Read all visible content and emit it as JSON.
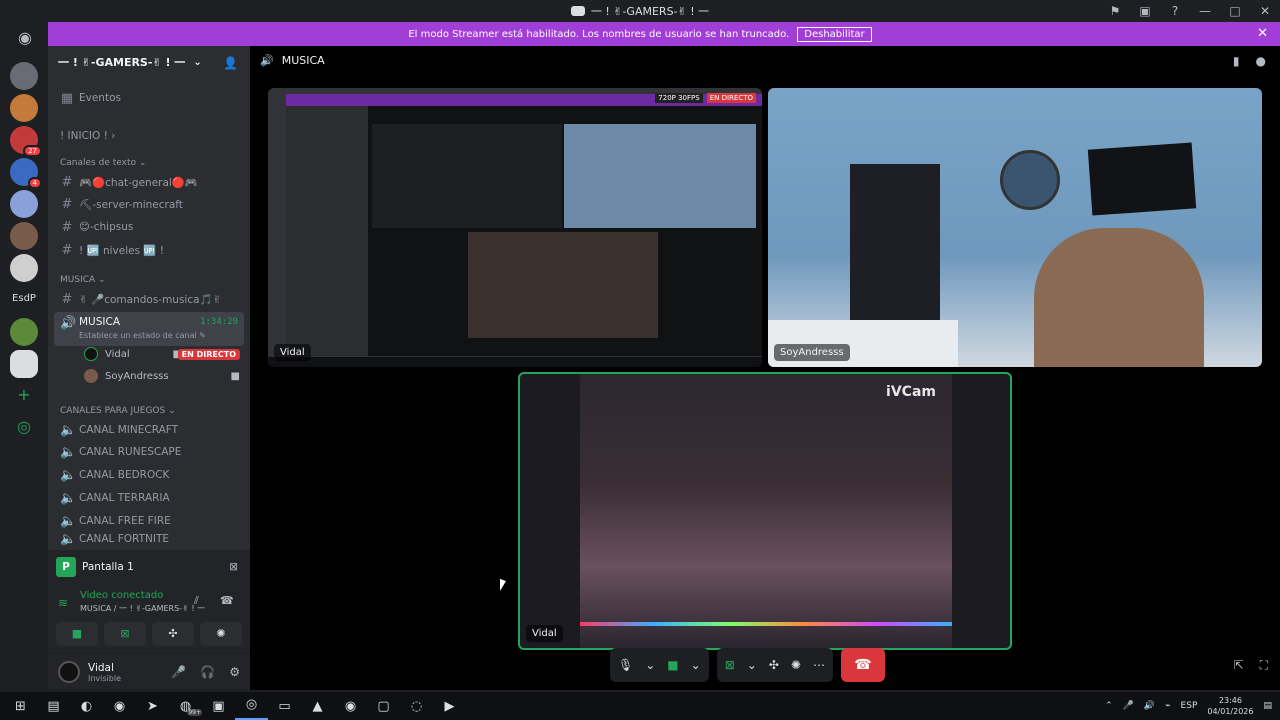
{
  "window": {
    "title": "⼀ ! ✌-GAMERS-✌ ! ⼀",
    "controls": [
      "—",
      "□",
      "✕"
    ]
  },
  "streamer_bar": {
    "message": "El modo Streamer está habilitado. Los nombres de usuario se han truncado.",
    "button": "Deshabilitar"
  },
  "rail": {
    "badge_1": "27",
    "badge_2": "4",
    "label_esdp": "EsdP"
  },
  "guild": {
    "name": "⼀ ! ✌-GAMERS-✌ ! ⼀"
  },
  "sidebar": {
    "eventos": "Eventos",
    "inicio": "! INICIO ! ›",
    "cat_texto": "Canales de texto",
    "text_channels": [
      {
        "label": "🎮🔴chat-general🔴🎮"
      },
      {
        "label": "⛏-server-minecraft"
      },
      {
        "label": "😊-chipsus"
      },
      {
        "label": "! 🆙 niveles 🆙 !"
      }
    ],
    "cat_musica": "MUSICA",
    "musica_cmd": "✌ 🎤comandos-musica🎵✌",
    "voice_active": {
      "name": "MUSICA",
      "timer": "1:34:29",
      "status": "Establece un estado de canal ✎"
    },
    "voice_users": [
      {
        "name": "Vidal",
        "badge": "EN DIRECTO"
      },
      {
        "name": "SoyAndresss"
      }
    ],
    "cat_juegos": "CANALES PARA JUEGOS",
    "game_channels": [
      {
        "label": "CANAL MINECRAFT"
      },
      {
        "label": "CANAL RUNESCAPE"
      },
      {
        "label": "CANAL BEDROCK"
      },
      {
        "label": "CANAL TERRARIA"
      },
      {
        "label": "CANAL FREE FIRE"
      },
      {
        "label": "CANAL FORTNITE"
      }
    ]
  },
  "voice_panel": {
    "screen_label": "Pantalla 1",
    "connected": "Video conectado",
    "channel_path": "MUSICA / ⼀ ! ✌-GAMERS-✌ ! ⼀"
  },
  "user": {
    "name": "Vidal",
    "status": "Invisible"
  },
  "stage": {
    "channel": "MUSICA",
    "tiles": [
      {
        "label": "Vidal",
        "preview_res": "720P 30FPS",
        "preview_live": "EN DIRECTO"
      },
      {
        "label": "SoyAndresss"
      },
      {
        "label": "Vidal",
        "watermark": "iVCam"
      }
    ]
  },
  "taskbar": {
    "lang": "ESP",
    "time": "23:46",
    "date": "04/01/2026",
    "notif_count": "99+"
  }
}
